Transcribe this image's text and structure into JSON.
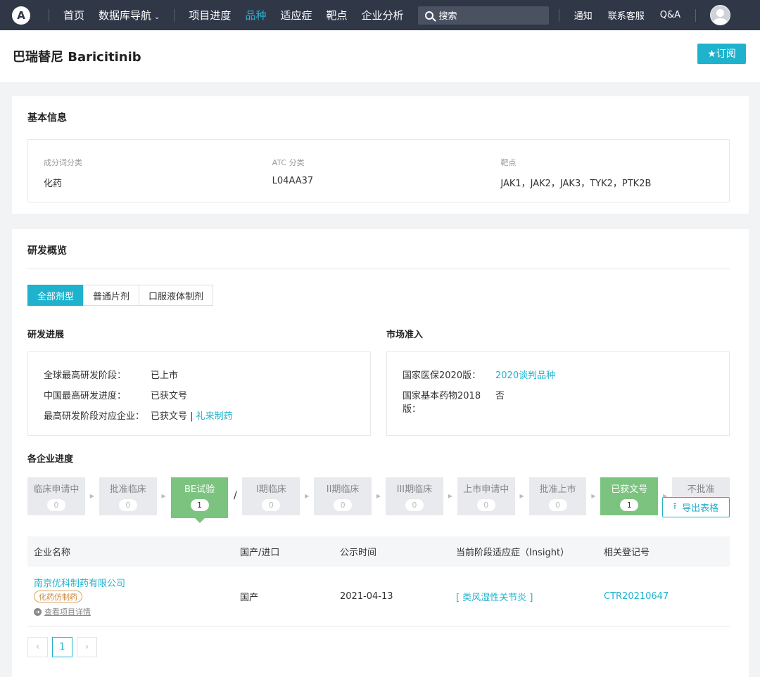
{
  "nav": {
    "logo_glyph": "A",
    "items": [
      "首页",
      "数据库导航",
      "项目进度",
      "品种",
      "适应症",
      "靶点",
      "企业分析"
    ],
    "active_index": 3,
    "search_placeholder": "搜索",
    "right_items": [
      "通知",
      "联系客服",
      "Q&A"
    ]
  },
  "header": {
    "title": "巴瑞替尼 Baricitinib",
    "subscribe_label": "★订阅"
  },
  "basic": {
    "title": "基本信息",
    "fields": [
      {
        "label": "成分词分类",
        "value": "化药"
      },
      {
        "label": "ATC 分类",
        "value": "L04AA37"
      },
      {
        "label": "靶点",
        "value": "JAK1，JAK2，JAK3，TYK2，PTK2B"
      }
    ]
  },
  "rd": {
    "title": "研发概览",
    "tabs": [
      "全部剂型",
      "普通片剂",
      "口服液体制剂"
    ],
    "progress": {
      "title": "研发进展",
      "rows": [
        {
          "k": "全球最高研发阶段：",
          "v": "已上市"
        },
        {
          "k": "中国最高研发进度：",
          "v": "已获文号"
        },
        {
          "k": "最高研发阶段对应企业：",
          "v": "已获文号 |",
          "link": "礼来制药"
        }
      ]
    },
    "market": {
      "title": "市场准入",
      "rows": [
        {
          "k": "国家医保2020版：",
          "link": "2020谈判品种"
        },
        {
          "k": "国家基本药物2018版：",
          "v": "否"
        }
      ]
    },
    "stages_title": "各企业进度",
    "stages": [
      {
        "label": "临床申请中",
        "count": "0"
      },
      {
        "label": "批准临床",
        "count": "0"
      },
      {
        "label": "BE试验",
        "count": "1"
      },
      {
        "label": "I期临床",
        "count": "0"
      },
      {
        "label": "II期临床",
        "count": "0"
      },
      {
        "label": "III期临床",
        "count": "0"
      },
      {
        "label": "上市申请中",
        "count": "0"
      },
      {
        "label": "批准上市",
        "count": "0"
      },
      {
        "label": "已获文号",
        "count": "1"
      },
      {
        "label": "不批准",
        "count": ""
      }
    ],
    "slash": "/",
    "export_label": "导出表格",
    "table": {
      "headers": [
        "企业名称",
        "国产/进口",
        "公示时间",
        "当前阶段适应症（Insight）",
        "相关登记号"
      ],
      "rows": [
        {
          "company": "南京优科制药有限公司",
          "tag": "化药仿制药",
          "detail": "查看项目详情",
          "origin": "国产",
          "date": "2021-04-13",
          "indication": "[ 类风湿性关节炎 ]",
          "reg": "CTR20210647"
        }
      ]
    },
    "pager": {
      "prev": "‹",
      "page": "1",
      "next": "›"
    }
  }
}
